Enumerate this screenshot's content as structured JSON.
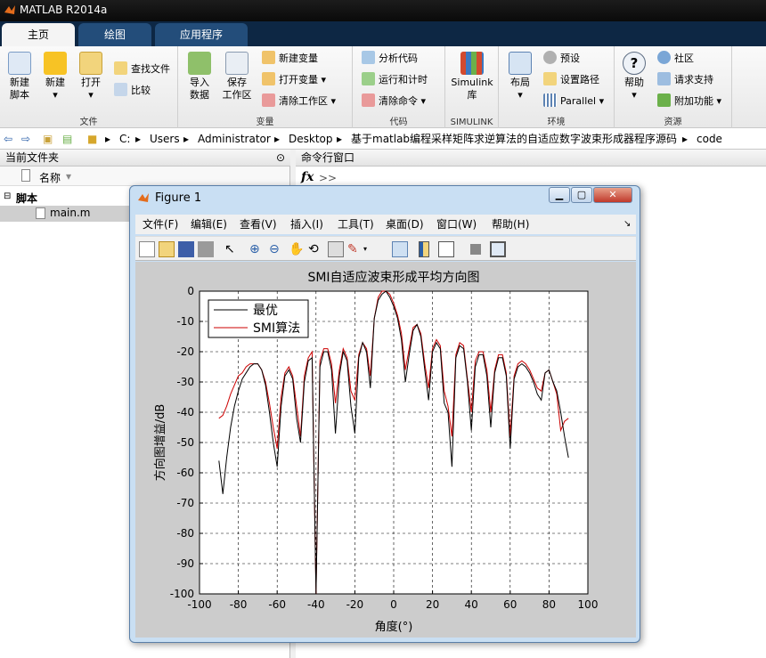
{
  "app": {
    "title": "MATLAB R2014a"
  },
  "tabs": [
    {
      "label": "主页"
    },
    {
      "label": "绘图"
    },
    {
      "label": "应用程序"
    }
  ],
  "ribbon": {
    "file": {
      "new_script": "新建\n脚本",
      "new": "新建",
      "open": "打开",
      "find_files": "查找文件",
      "compare": "比较",
      "group": "文件"
    },
    "variable": {
      "import": "导入\n数据",
      "save_ws": "保存\n工作区",
      "new_var": "新建变量",
      "open_var": "打开变量",
      "clear_ws": "清除工作区",
      "group": "变量"
    },
    "code": {
      "analyze": "分析代码",
      "run_time": "运行和计时",
      "clear_cmd": "清除命令",
      "group": "代码"
    },
    "simulink": {
      "lib": "Simulink\n库",
      "group": "SIMULINK"
    },
    "env": {
      "layout": "布局",
      "prefs": "预设",
      "set_path": "设置路径",
      "parallel": "Parallel",
      "group": "环境"
    },
    "resources": {
      "help": "帮助",
      "community": "社区",
      "request_support": "请求支持",
      "addons": "附加功能",
      "group": "资源"
    }
  },
  "address": {
    "path": [
      "C:",
      "Users",
      "Administrator",
      "Desktop",
      "基于matlab编程采样矩阵求逆算法的自适应数字波束形成器程序源码",
      "code"
    ]
  },
  "left_panel": {
    "title": "当前文件夹",
    "column_name": "名称",
    "group": "脚本",
    "file": "main.m"
  },
  "command_window": {
    "title": "命令行窗口",
    "fx": "fx",
    "prompt": ">>"
  },
  "figure": {
    "title": "Figure 1",
    "menu": [
      "文件(F)",
      "编辑(E)",
      "查看(V)",
      "插入(I)",
      "工具(T)",
      "桌面(D)",
      "窗口(W)",
      "帮助(H)"
    ]
  },
  "chart_data": {
    "type": "line",
    "title": "SMI自适应波束形成平均方向图",
    "xlabel": "角度(°)",
    "ylabel": "方向图增益/dB",
    "xlim": [
      -100,
      100
    ],
    "ylim": [
      -100,
      0
    ],
    "xticks": [
      -100,
      -80,
      -60,
      -40,
      -20,
      0,
      20,
      40,
      60,
      80,
      100
    ],
    "yticks": [
      0,
      -10,
      -20,
      -30,
      -40,
      -50,
      -60,
      -70,
      -80,
      -90,
      -100
    ],
    "grid": true,
    "legend_position": "top-left",
    "series": [
      {
        "name": "最优",
        "color": "#000000",
        "x": [
          -90,
          -88,
          -86,
          -84,
          -82,
          -80,
          -78,
          -76,
          -74,
          -72,
          -70,
          -68,
          -66,
          -64,
          -62,
          -60,
          -58,
          -56,
          -54,
          -52,
          -50,
          -48,
          -46,
          -44,
          -42,
          -40,
          -38,
          -36,
          -34,
          -32,
          -30,
          -28,
          -26,
          -24,
          -22,
          -20,
          -18,
          -16,
          -14,
          -12,
          -10,
          -8,
          -6,
          -4,
          -2,
          0,
          2,
          4,
          6,
          8,
          10,
          12,
          14,
          16,
          18,
          20,
          22,
          24,
          26,
          28,
          30,
          32,
          34,
          36,
          38,
          40,
          42,
          44,
          46,
          48,
          50,
          52,
          54,
          56,
          58,
          60,
          62,
          64,
          66,
          68,
          70,
          72,
          74,
          76,
          78,
          80,
          82,
          84,
          86,
          88,
          90
        ],
        "y": [
          -56,
          -67,
          -55,
          -45,
          -38,
          -33,
          -29,
          -27,
          -25,
          -24,
          -24,
          -26,
          -31,
          -40,
          -50,
          -58,
          -38,
          -28,
          -26,
          -29,
          -42,
          -50,
          -30,
          -23,
          -22,
          -100,
          -25,
          -20,
          -20,
          -26,
          -47,
          -28,
          -20,
          -23,
          -38,
          -47,
          -22,
          -17,
          -20,
          -32,
          -9,
          -3,
          -1,
          0,
          -2,
          -5,
          -9,
          -16,
          -30,
          -21,
          -13,
          -11,
          -15,
          -26,
          -36,
          -20,
          -17,
          -19,
          -37,
          -40,
          -58,
          -22,
          -18,
          -19,
          -30,
          -46,
          -25,
          -21,
          -21,
          -28,
          -45,
          -27,
          -22,
          -22,
          -28,
          -52,
          -29,
          -25,
          -24,
          -25,
          -27,
          -30,
          -34,
          -36,
          -27,
          -26,
          -30,
          -33,
          -40,
          -48,
          -55
        ]
      },
      {
        "name": "SMI算法",
        "color": "#cc0000",
        "x": [
          -90,
          -88,
          -86,
          -84,
          -82,
          -80,
          -78,
          -76,
          -74,
          -72,
          -70,
          -68,
          -66,
          -64,
          -62,
          -60,
          -58,
          -56,
          -54,
          -52,
          -50,
          -48,
          -46,
          -44,
          -42,
          -40,
          -38,
          -36,
          -34,
          -32,
          -30,
          -28,
          -26,
          -24,
          -22,
          -20,
          -18,
          -16,
          -14,
          -12,
          -10,
          -8,
          -6,
          -4,
          -2,
          0,
          2,
          4,
          6,
          8,
          10,
          12,
          14,
          16,
          18,
          20,
          22,
          24,
          26,
          28,
          30,
          32,
          34,
          36,
          38,
          40,
          42,
          44,
          46,
          48,
          50,
          52,
          54,
          56,
          58,
          60,
          62,
          64,
          66,
          68,
          70,
          72,
          74,
          76,
          78,
          80,
          82,
          84,
          86,
          88,
          90
        ],
        "y": [
          -42,
          -41,
          -38,
          -34,
          -31,
          -28,
          -27,
          -25,
          -24,
          -24,
          -24,
          -26,
          -30,
          -37,
          -45,
          -52,
          -35,
          -27,
          -25,
          -28,
          -38,
          -48,
          -28,
          -22,
          -20,
          -100,
          -23,
          -19,
          -19,
          -24,
          -37,
          -26,
          -19,
          -22,
          -33,
          -36,
          -21,
          -17,
          -19,
          -28,
          -9,
          -2,
          0,
          0,
          -1,
          -4,
          -8,
          -14,
          -26,
          -19,
          -12,
          -11,
          -14,
          -24,
          -32,
          -19,
          -16,
          -18,
          -33,
          -38,
          -48,
          -21,
          -17,
          -18,
          -29,
          -40,
          -23,
          -20,
          -20,
          -26,
          -40,
          -26,
          -21,
          -21,
          -27,
          -48,
          -28,
          -24,
          -23,
          -24,
          -26,
          -29,
          -32,
          -33,
          -27,
          -26,
          -30,
          -34,
          -46,
          -43,
          -42
        ]
      }
    ]
  }
}
